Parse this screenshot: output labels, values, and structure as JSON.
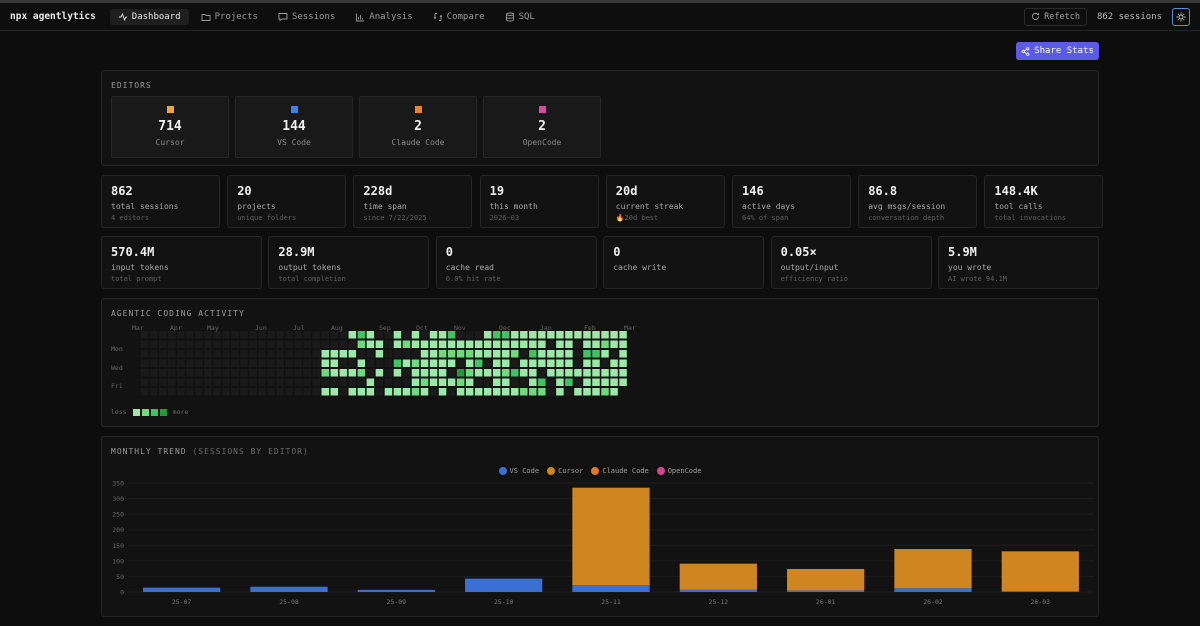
{
  "nav": {
    "brand": "npx agentlytics",
    "tabs": [
      {
        "label": "Dashboard",
        "icon": "activity-icon",
        "active": true
      },
      {
        "label": "Projects",
        "icon": "folder-icon",
        "active": false
      },
      {
        "label": "Sessions",
        "icon": "message-icon",
        "active": false
      },
      {
        "label": "Analysis",
        "icon": "bar-chart-icon",
        "active": false
      },
      {
        "label": "Compare",
        "icon": "compare-icon",
        "active": false
      },
      {
        "label": "SQL",
        "icon": "database-icon",
        "active": false
      }
    ],
    "refetch": "Refetch",
    "sessions": "862 sessions"
  },
  "share_label": "Share Stats",
  "editors": {
    "title": "EDITORS",
    "items": [
      {
        "count": "714",
        "name": "Cursor",
        "color": "#f2a33a"
      },
      {
        "count": "144",
        "name": "VS Code",
        "color": "#3b82f6"
      },
      {
        "count": "2",
        "name": "Claude Code",
        "color": "#f08224"
      },
      {
        "count": "2",
        "name": "OpenCode",
        "color": "#e0479e"
      }
    ]
  },
  "stats_row1": [
    {
      "value": "862",
      "label": "total sessions",
      "sub": "4 editors"
    },
    {
      "value": "20",
      "label": "projects",
      "sub": "unique folders"
    },
    {
      "value": "228d",
      "label": "time span",
      "sub": "since 7/22/2025"
    },
    {
      "value": "19",
      "label": "this month",
      "sub": "2026-03"
    },
    {
      "value": "20d",
      "label": "current streak",
      "sub": "🔥20d best"
    },
    {
      "value": "146",
      "label": "active days",
      "sub": "64% of span"
    },
    {
      "value": "86.8",
      "label": "avg msgs/session",
      "sub": "conversation depth"
    },
    {
      "value": "148.4K",
      "label": "tool calls",
      "sub": "total invocations"
    }
  ],
  "stats_row2": [
    {
      "value": "570.4M",
      "label": "input tokens",
      "sub": "total prompt"
    },
    {
      "value": "28.9M",
      "label": "output tokens",
      "sub": "total completion"
    },
    {
      "value": "0",
      "label": "cache read",
      "sub": "0.0% hit rate"
    },
    {
      "value": "0",
      "label": "cache write",
      "sub": ""
    },
    {
      "value": "0.05×",
      "label": "output/input",
      "sub": "efficiency ratio"
    },
    {
      "value": "5.9M",
      "label": "you wrote",
      "sub": "AI wrote 94.1M"
    }
  ],
  "activity": {
    "title": "AGENTIC CODING ACTIVITY",
    "months": [
      "Mar",
      "Apr",
      "May",
      "Jun",
      "Jul",
      "Aug",
      "Sep",
      "Oct",
      "Nov",
      "Dec",
      "Jan",
      "Feb",
      "Mar"
    ],
    "days": [
      "Mon",
      "Wed",
      "Fri"
    ],
    "less": "less",
    "more": "more",
    "colors": [
      "#1a1a1a",
      "#9be9a8",
      "#6fd97e",
      "#40c463",
      "#239a3b"
    ]
  },
  "trend": {
    "title": "MONTHLY TREND",
    "subtitle": "(SESSIONS BY EDITOR)"
  },
  "chart_data": {
    "type": "bar",
    "stacked": true,
    "title": "MONTHLY TREND (SESSIONS BY EDITOR)",
    "categories": [
      "25-07",
      "25-08",
      "25-09",
      "25-10",
      "25-11",
      "25-12",
      "26-01",
      "26-02",
      "26-03"
    ],
    "ylim": [
      0,
      350
    ],
    "yticks": [
      0,
      50,
      100,
      150,
      200,
      250,
      300,
      350
    ],
    "series": [
      {
        "name": "VS Code",
        "color": "#3b6fd4",
        "values": [
          14,
          17,
          7,
          43,
          22,
          8,
          5,
          12,
          3
        ]
      },
      {
        "name": "Cursor",
        "color": "#cf8520",
        "values": [
          0,
          0,
          0,
          0,
          313,
          83,
          69,
          126,
          126
        ]
      },
      {
        "name": "Claude Code",
        "color": "#e0782a",
        "values": [
          0,
          0,
          0,
          0,
          0,
          0,
          0,
          0,
          1
        ]
      },
      {
        "name": "OpenCode",
        "color": "#d0458e",
        "values": [
          0,
          0,
          0,
          0,
          0,
          0,
          0,
          0,
          1
        ]
      }
    ],
    "legend_position": "top-center",
    "grid": true
  }
}
